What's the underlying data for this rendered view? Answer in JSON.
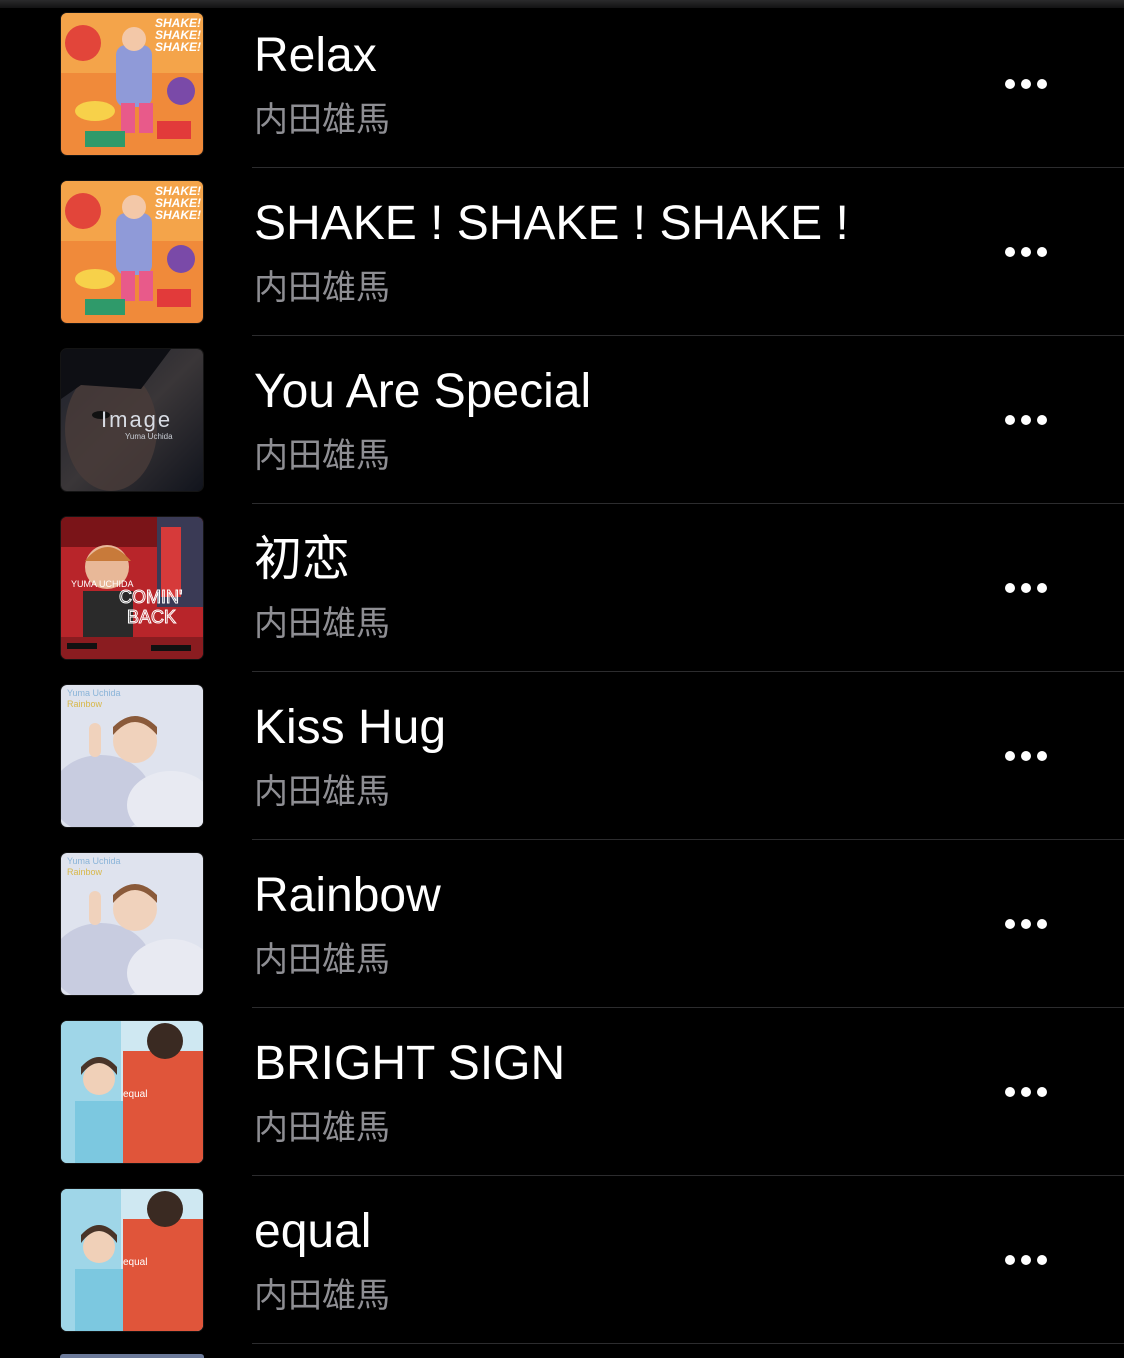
{
  "tracks": [
    {
      "title": "Relax",
      "artist": "内田雄馬",
      "art": "shake-cover-art",
      "more_icon": "more-dots-icon"
    },
    {
      "title": "SHAKE ! SHAKE ! SHAKE !",
      "artist": "内田雄馬",
      "art": "shake-cover-art",
      "more_icon": "more-dots-icon"
    },
    {
      "title": "You Are Special",
      "artist": "内田雄馬",
      "art": "image-cover-art",
      "more_icon": "more-dots-icon"
    },
    {
      "title": "初恋",
      "artist": "内田雄馬",
      "art": "comin-back-cover-art",
      "more_icon": "more-dots-icon"
    },
    {
      "title": "Kiss Hug",
      "artist": "内田雄馬",
      "art": "rainbow-cover-art",
      "more_icon": "more-dots-icon"
    },
    {
      "title": "Rainbow",
      "artist": "内田雄馬",
      "art": "rainbow-cover-art",
      "more_icon": "more-dots-icon"
    },
    {
      "title": "BRIGHT SIGN",
      "artist": "内田雄馬",
      "art": "equal-cover-art",
      "more_icon": "more-dots-icon"
    },
    {
      "title": "equal",
      "artist": "内田雄馬",
      "art": "equal-cover-art",
      "more_icon": "more-dots-icon"
    }
  ],
  "cover_text": {
    "shake": "SHAKE!",
    "image_title": "Image",
    "image_sub": "Yuma Uchida",
    "comin_top": "YUMA UCHIDA",
    "comin_1": "COMIN'",
    "comin_2": "BACK",
    "rainbow_1": "Yuma Uchida",
    "rainbow_2": "Rainbow",
    "equal": "equal"
  },
  "colors": {
    "background": "#000000",
    "title": "#ffffff",
    "artist": "#8e8e93",
    "separator": "#2c2c2e"
  }
}
